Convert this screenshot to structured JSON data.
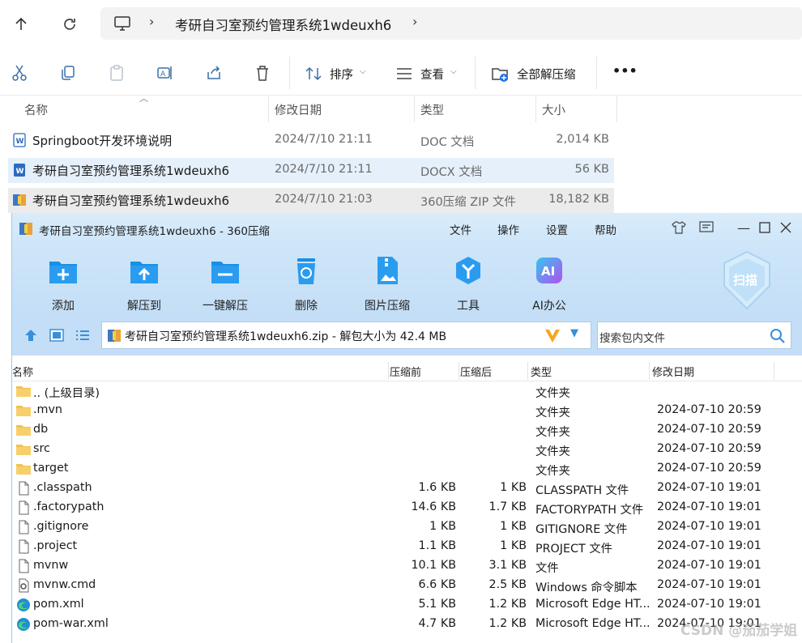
{
  "explorer": {
    "breadcrumb_title": "考研自习室预约管理系统1wdeuxh6",
    "toolbar": {
      "sort_label": "排序",
      "view_label": "查看",
      "extract_all_label": "全部解压缩",
      "more_label": "•••"
    },
    "columns": {
      "name": "名称",
      "date": "修改日期",
      "type": "类型",
      "size": "大小"
    },
    "files": [
      {
        "name": "Springboot开发环境说明",
        "date": "2024/7/10 21:11",
        "type": "DOC 文档",
        "size": "2,014 KB",
        "icon": "word-doc-icon"
      },
      {
        "name": "考研自习室预约管理系统1wdeuxh6",
        "date": "2024/7/10 21:11",
        "type": "DOCX 文档",
        "size": "56 KB",
        "icon": "word-docx-icon"
      },
      {
        "name": "考研自习室预约管理系统1wdeuxh6",
        "date": "2024/7/10 21:03",
        "type": "360压缩 ZIP 文件",
        "size": "18,182 KB",
        "icon": "zip-archive-icon"
      }
    ]
  },
  "zip": {
    "title": "考研自习室预约管理系统1wdeuxh6 - 360压缩",
    "menu": [
      "文件",
      "操作",
      "设置",
      "帮助"
    ],
    "ribbon": [
      {
        "label": "添加",
        "icon": "add-icon"
      },
      {
        "label": "解压到",
        "icon": "extract-to-icon"
      },
      {
        "label": "一键解压",
        "icon": "one-click-extract-icon"
      },
      {
        "label": "删除",
        "icon": "delete-icon"
      },
      {
        "label": "图片压缩",
        "icon": "image-compress-icon"
      },
      {
        "label": "工具",
        "icon": "tools-icon"
      },
      {
        "label": "AI办公",
        "icon": "ai-office-icon"
      }
    ],
    "scan_label": "扫描",
    "ai_badge": "AI",
    "path_text": "考研自习室预约管理系统1wdeuxh6.zip - 解包大小为 42.4 MB",
    "search_placeholder": "搜索包内文件",
    "columns": {
      "name": "名称",
      "before": "压缩前",
      "after": "压缩后",
      "type": "类型",
      "date": "修改日期"
    },
    "rows": [
      {
        "name": ".. (上级目录)",
        "before": "",
        "after": "",
        "type": "文件夹",
        "date": "",
        "icon": "folder-icon"
      },
      {
        "name": ".mvn",
        "before": "",
        "after": "",
        "type": "文件夹",
        "date": "2024-07-10 20:59",
        "icon": "folder-icon"
      },
      {
        "name": "db",
        "before": "",
        "after": "",
        "type": "文件夹",
        "date": "2024-07-10 20:59",
        "icon": "folder-icon"
      },
      {
        "name": "src",
        "before": "",
        "after": "",
        "type": "文件夹",
        "date": "2024-07-10 20:59",
        "icon": "folder-icon"
      },
      {
        "name": "target",
        "before": "",
        "after": "",
        "type": "文件夹",
        "date": "2024-07-10 20:59",
        "icon": "folder-icon"
      },
      {
        "name": ".classpath",
        "before": "1.6 KB",
        "after": "1 KB",
        "type": "CLASSPATH 文件",
        "date": "2024-07-10 19:01",
        "icon": "file-icon"
      },
      {
        "name": ".factorypath",
        "before": "14.6 KB",
        "after": "1.7 KB",
        "type": "FACTORYPATH 文件",
        "date": "2024-07-10 19:01",
        "icon": "file-icon"
      },
      {
        "name": ".gitignore",
        "before": "1 KB",
        "after": "1 KB",
        "type": "GITIGNORE 文件",
        "date": "2024-07-10 19:01",
        "icon": "file-icon"
      },
      {
        "name": ".project",
        "before": "1.1 KB",
        "after": "1 KB",
        "type": "PROJECT 文件",
        "date": "2024-07-10 19:01",
        "icon": "file-icon"
      },
      {
        "name": "mvnw",
        "before": "10.1 KB",
        "after": "3.1 KB",
        "type": "文件",
        "date": "2024-07-10 19:01",
        "icon": "file-icon"
      },
      {
        "name": "mvnw.cmd",
        "before": "6.6 KB",
        "after": "2.5 KB",
        "type": "Windows 命令脚本",
        "date": "2024-07-10 19:01",
        "icon": "cmd-script-icon"
      },
      {
        "name": "pom.xml",
        "before": "5.1 KB",
        "after": "1.2 KB",
        "type": "Microsoft Edge HT...",
        "date": "2024-07-10 19:01",
        "icon": "edge-icon"
      },
      {
        "name": "pom-war.xml",
        "before": "4.7 KB",
        "after": "1.2 KB",
        "type": "Microsoft Edge HT...",
        "date": "2024-07-10 19:01",
        "icon": "edge-icon"
      }
    ]
  },
  "watermark": "CSDN @茄茄学姐",
  "colors": {
    "accent": "#1a8fe3",
    "ribbon_bg": "#c9e2f7",
    "selected_row": "#e5f0fb",
    "zip_row": "#ebebeb"
  }
}
